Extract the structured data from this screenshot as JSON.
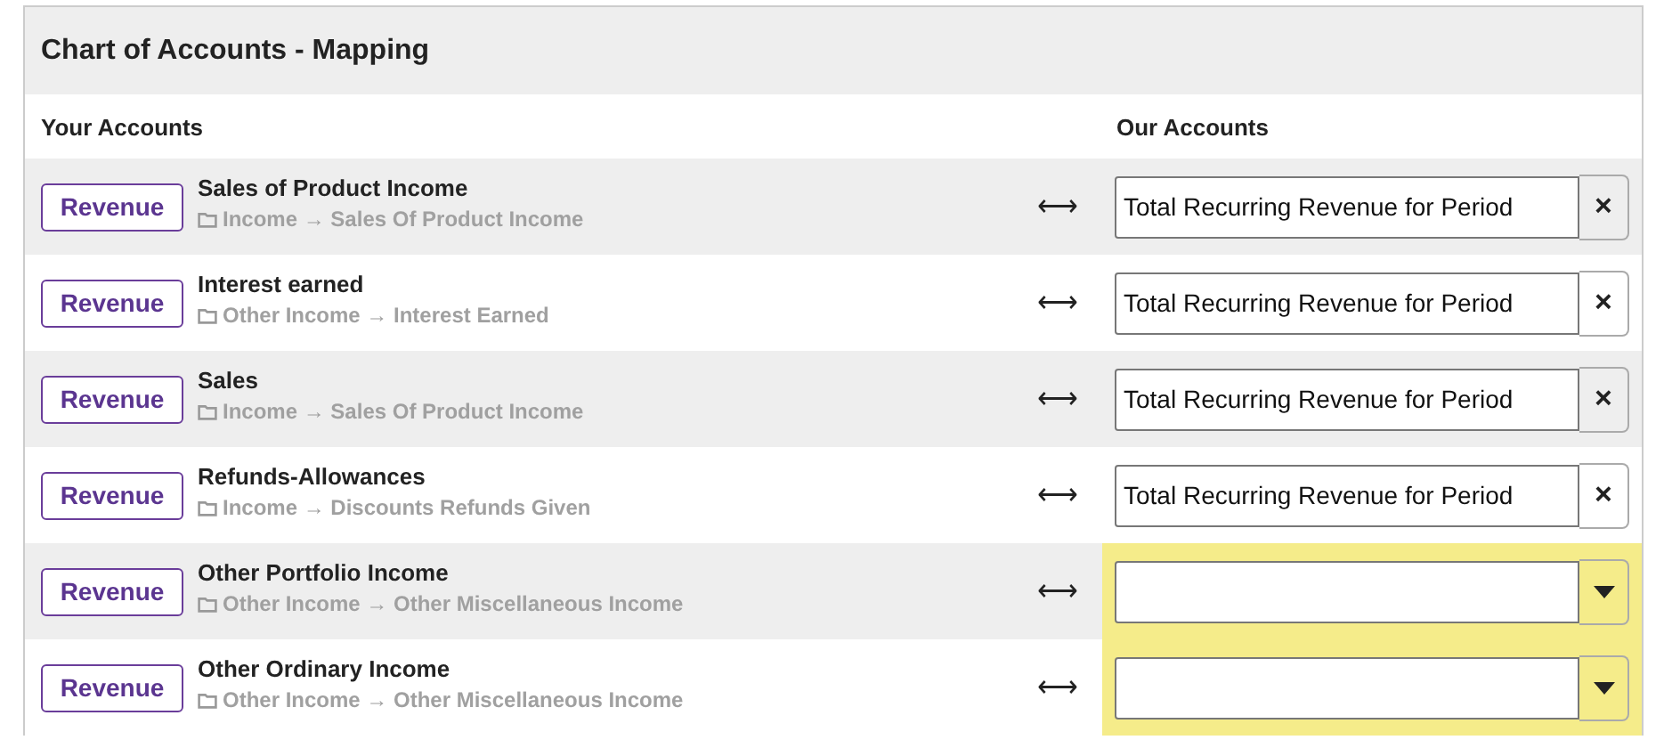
{
  "panel": {
    "title": "Chart of Accounts - Mapping"
  },
  "columns": {
    "left": "Your Accounts",
    "right": "Our Accounts"
  },
  "rows": [
    {
      "type_label": "Revenue",
      "name": "Sales of Product Income",
      "path_from": "Income",
      "path_arrow": "→",
      "path_to": "Sales Of Product Income",
      "link": "⟷",
      "kind": "mapped",
      "value": "Total Recurring Revenue for Period",
      "clear": "×"
    },
    {
      "type_label": "Revenue",
      "name": "Interest earned",
      "path_from": "Other Income",
      "path_arrow": "→",
      "path_to": "Interest Earned",
      "link": "⟷",
      "kind": "mapped",
      "value": "Total Recurring Revenue for Period",
      "clear": "×"
    },
    {
      "type_label": "Revenue",
      "name": "Sales",
      "path_from": "Income",
      "path_arrow": "→",
      "path_to": "Sales Of Product Income",
      "link": "⟷",
      "kind": "mapped",
      "value": "Total Recurring Revenue for Period",
      "clear": "×"
    },
    {
      "type_label": "Revenue",
      "name": "Refunds-Allowances",
      "path_from": "Income",
      "path_arrow": "→",
      "path_to": "Discounts Refunds Given",
      "link": "⟷",
      "kind": "mapped",
      "value": "Total Recurring Revenue for Period",
      "clear": "×"
    },
    {
      "type_label": "Revenue",
      "name": "Other Portfolio Income",
      "path_from": "Other Income",
      "path_arrow": "→",
      "path_to": "Other Miscellaneous Income",
      "link": "⟷",
      "kind": "unmapped"
    },
    {
      "type_label": "Revenue",
      "name": "Other Ordinary Income",
      "path_from": "Other Income",
      "path_arrow": "→",
      "path_to": "Other Miscellaneous Income",
      "link": "⟷",
      "kind": "unmapped"
    }
  ]
}
